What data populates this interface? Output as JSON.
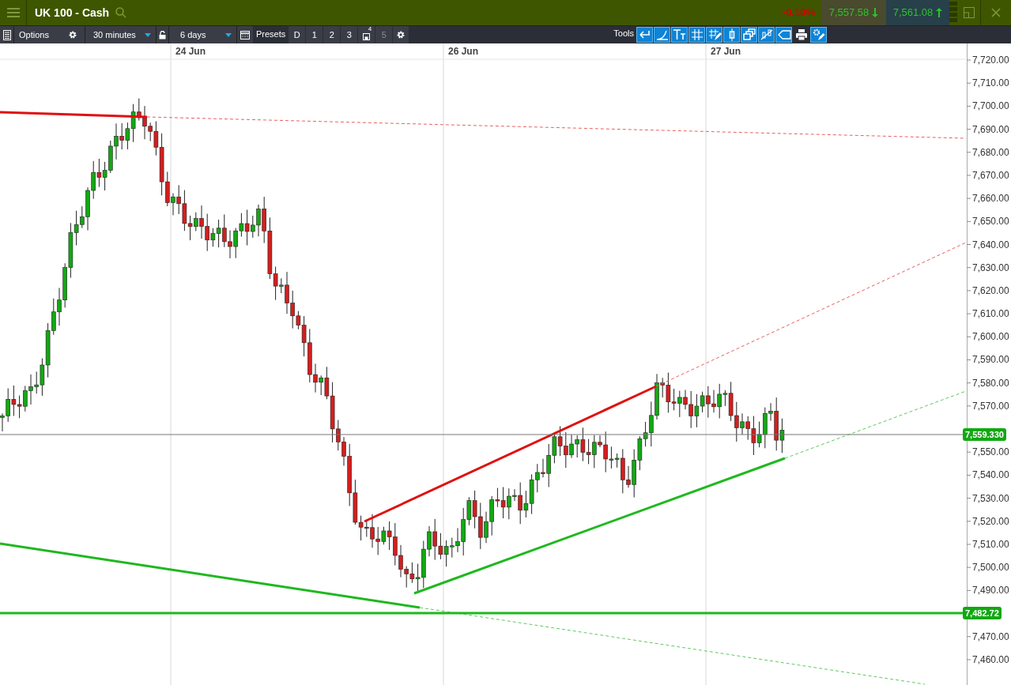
{
  "header": {
    "title": "UK 100 - Cash",
    "change": "-0.10%",
    "sell": "7,557.58",
    "buy": "7,561.08"
  },
  "toolbar": {
    "options": "Options",
    "interval": "30 minutes",
    "range": "6 days",
    "presets": "Presets",
    "preset_buttons": [
      {
        "label": "D",
        "kind": "text",
        "disabled": false
      },
      {
        "label": "1",
        "kind": "text",
        "disabled": false
      },
      {
        "label": "2",
        "kind": "text",
        "disabled": false
      },
      {
        "label": "3",
        "kind": "text",
        "disabled": false
      },
      {
        "label": "4",
        "kind": "save",
        "disabled": false
      },
      {
        "label": "5",
        "kind": "text",
        "disabled": true
      }
    ],
    "tools_label": "Tools"
  },
  "chart": {
    "dates": [
      "24 Jun",
      "26 Jun",
      "27 Jun"
    ],
    "price_ticks": [
      "7,720.00",
      "7,710.00",
      "7,700.00",
      "7,690.00",
      "7,680.00",
      "7,670.00",
      "7,660.00",
      "7,650.00",
      "7,640.00",
      "7,630.00",
      "7,620.00",
      "7,610.00",
      "7,600.00",
      "7,590.00",
      "7,580.00",
      "7,570.00",
      "7,550.00",
      "7,540.00",
      "7,530.00",
      "7,520.00",
      "7,510.00",
      "7,500.00",
      "7,490.00",
      "7,470.00",
      "7,460.00"
    ],
    "current_price": "7,559.330",
    "level_price": "7,482.72"
  }
}
